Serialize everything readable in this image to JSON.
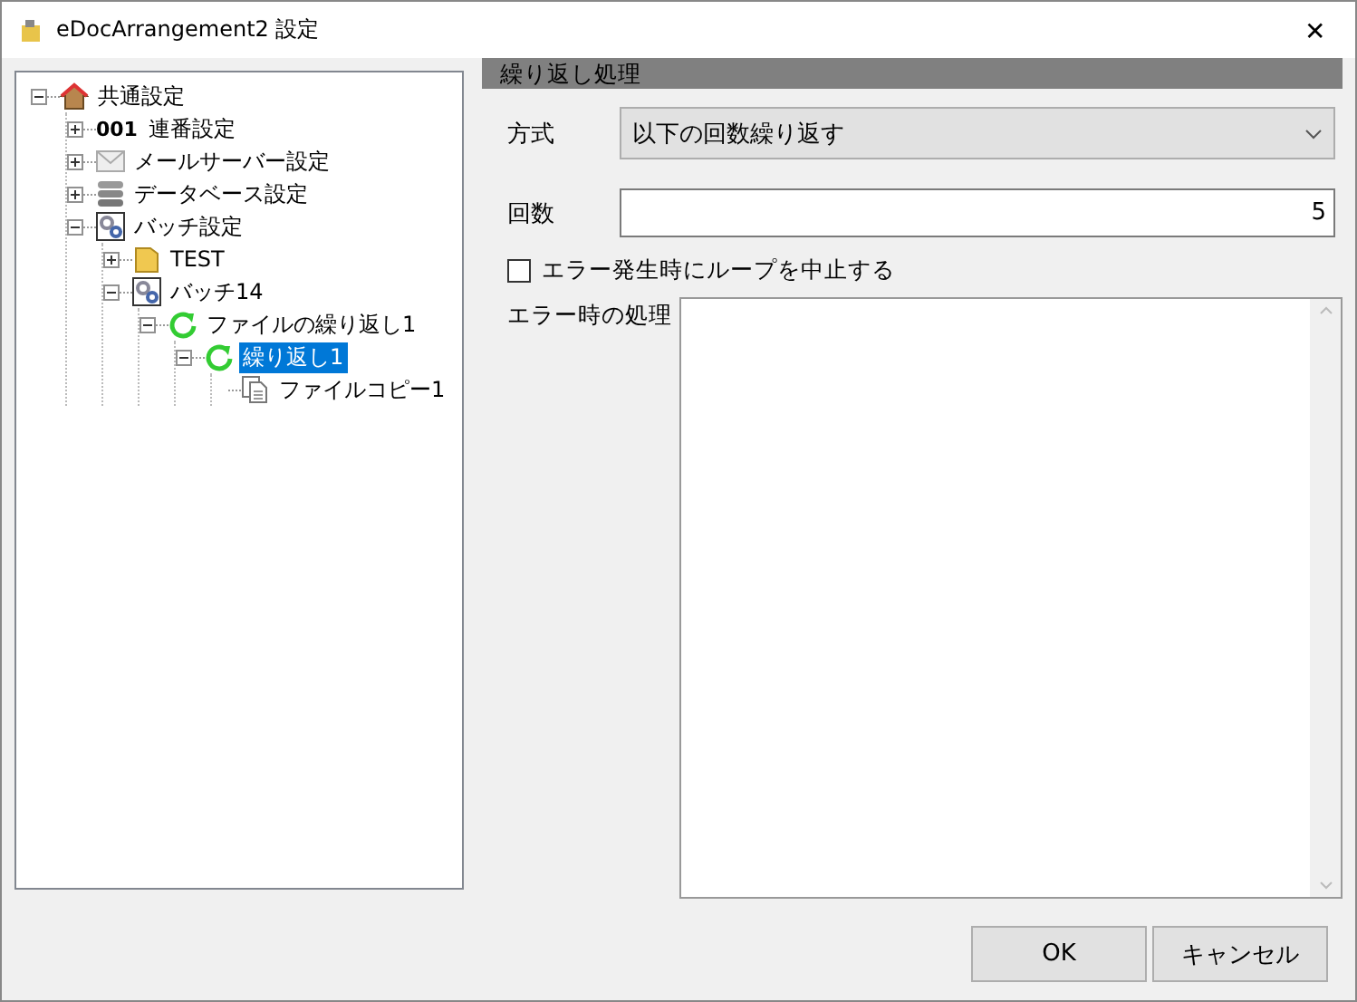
{
  "window": {
    "title": "eDocArrangement2 設定",
    "close": "✕"
  },
  "tree": [
    {
      "label": "共通設定",
      "kind": "house",
      "expanded": true,
      "selected": false,
      "children": [
        {
          "label": "連番設定",
          "kind": "number",
          "icon_text": "001",
          "expanded": false,
          "selected": false
        },
        {
          "label": "メールサーバー設定",
          "kind": "mail",
          "expanded": false,
          "selected": false
        },
        {
          "label": "データベース設定",
          "kind": "database",
          "expanded": false,
          "selected": false
        },
        {
          "label": "バッチ設定",
          "kind": "gears",
          "expanded": true,
          "selected": false,
          "children": [
            {
              "label": "TEST",
              "kind": "folder",
              "expanded": false,
              "selected": false
            },
            {
              "label": "バッチ14",
              "kind": "gears",
              "expanded": true,
              "selected": false,
              "children": [
                {
                  "label": "ファイルの繰り返し1",
                  "kind": "loop",
                  "expanded": true,
                  "selected": false,
                  "children": [
                    {
                      "label": "繰り返し1",
                      "kind": "loop",
                      "expanded": true,
                      "selected": true,
                      "children": [
                        {
                          "label": "ファイルコピー1",
                          "kind": "file",
                          "selected": false
                        }
                      ]
                    }
                  ]
                }
              ]
            }
          ]
        }
      ]
    }
  ],
  "panel": {
    "title": "繰り返し処理",
    "method": {
      "label": "方式",
      "value": "以下の回数繰り返す"
    },
    "count": {
      "label": "回数",
      "value": "5"
    },
    "stop_on_error": {
      "label": "エラー発生時にループを中止する",
      "checked": false
    },
    "error_action": {
      "label": "エラー時の処理"
    }
  },
  "buttons": [
    "OK",
    "キャンセル"
  ]
}
